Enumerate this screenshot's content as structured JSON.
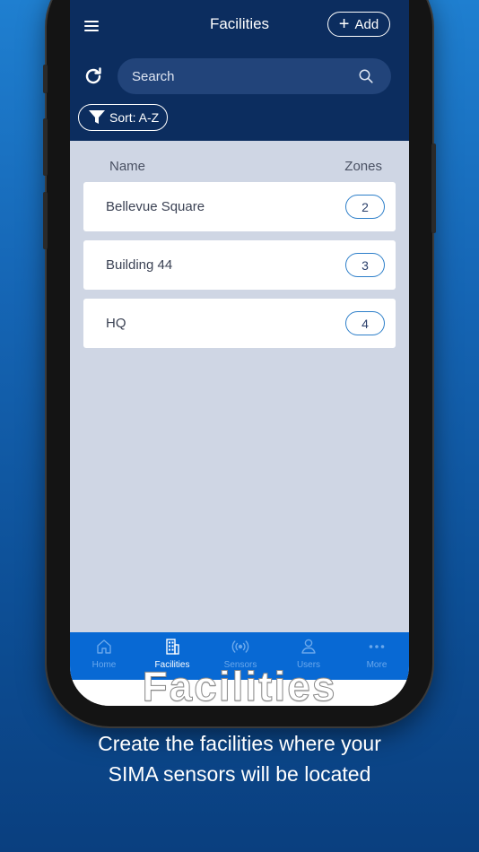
{
  "header": {
    "title": "Facilities",
    "add_label": "Add"
  },
  "search": {
    "placeholder": "Search"
  },
  "sort": {
    "label": "Sort: A-Z"
  },
  "table": {
    "columns": [
      "Name",
      "Zones"
    ],
    "rows": [
      {
        "name": "Bellevue Square",
        "zones": "2"
      },
      {
        "name": "Building 44",
        "zones": "3"
      },
      {
        "name": "HQ",
        "zones": "4"
      }
    ]
  },
  "tabbar": {
    "tabs": [
      {
        "label": "Home",
        "icon": "home-icon",
        "active": false
      },
      {
        "label": "Facilities",
        "icon": "building-icon",
        "active": true
      },
      {
        "label": "Sensors",
        "icon": "sensor-icon",
        "active": false
      },
      {
        "label": "Users",
        "icon": "user-icon",
        "active": false
      },
      {
        "label": "More",
        "icon": "more-icon",
        "active": false
      }
    ]
  },
  "promo": {
    "title": "Facilities",
    "subtitle_line1": "Create the facilities where your",
    "subtitle_line2": "SIMA sensors will be located"
  },
  "colors": {
    "header_bg": "#0c2d5f",
    "tabbar_bg": "#0869d4",
    "content_bg": "#cfd6e4",
    "badge_border": "#2c7ec9"
  }
}
